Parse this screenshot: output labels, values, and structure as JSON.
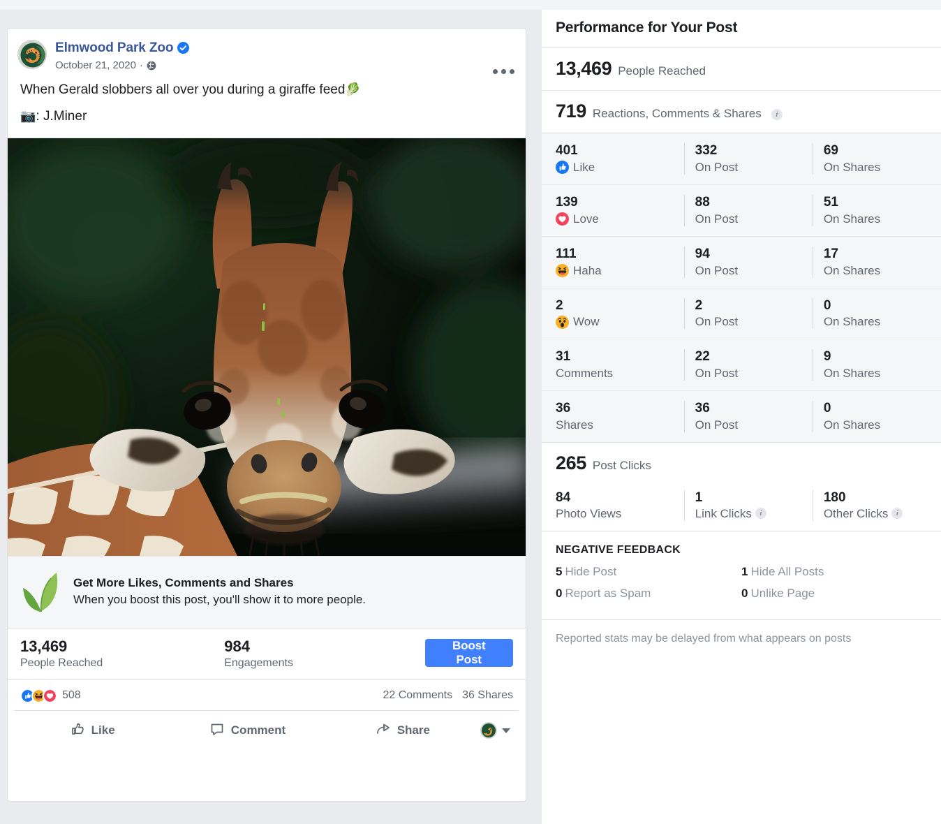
{
  "post": {
    "page_name": "Elmwood Park Zoo",
    "verified_icon": "verified-badge-icon",
    "date": "October 21, 2020",
    "date_separator": "·",
    "audience_icon": "globe-icon",
    "menu_icon": "more-options-icon",
    "text_line_1": "When Gerald slobbers all over you during a giraffe feed",
    "text_line_1_emoji": "🥬",
    "text_line_2_emoji": "📷",
    "text_line_2": ": J.Miner",
    "photo_alt": "giraffe-photo"
  },
  "promo": {
    "icon": "leaf-icon",
    "title": "Get More Likes, Comments and Shares",
    "subtitle": "When you boost this post, you'll show it to more people."
  },
  "metrics": {
    "reach_value": "13,469",
    "reach_label": "People Reached",
    "engagements_value": "984",
    "engagements_label": "Engagements",
    "boost_button": "Boost Post"
  },
  "reactbar": {
    "count": "508",
    "comments": "22 Comments",
    "shares": "36 Shares",
    "pills": [
      "like-icon",
      "haha-icon",
      "love-icon"
    ]
  },
  "actions": {
    "like": "Like",
    "comment": "Comment",
    "share": "Share",
    "like_icon": "thumbs-up-icon",
    "comment_icon": "comment-bubble-icon",
    "share_icon": "share-arrow-icon",
    "share_as_icon": "page-avatar-icon",
    "share_as_caret": "chevron-down-icon"
  },
  "performance": {
    "title": "Performance for Your Post",
    "reach": {
      "value": "13,469",
      "label": "People Reached"
    },
    "engagement": {
      "value": "719",
      "label": "Reactions, Comments & Shares",
      "info": "info-icon"
    },
    "rows": [
      {
        "icon": "like-icon",
        "total": "401",
        "label": "Like",
        "on_post": "332",
        "on_post_label": "On Post",
        "on_shares": "69",
        "on_shares_label": "On Shares"
      },
      {
        "icon": "love-icon",
        "total": "139",
        "label": "Love",
        "on_post": "88",
        "on_post_label": "On Post",
        "on_shares": "51",
        "on_shares_label": "On Shares"
      },
      {
        "icon": "haha-icon",
        "total": "111",
        "label": "Haha",
        "on_post": "94",
        "on_post_label": "On Post",
        "on_shares": "17",
        "on_shares_label": "On Shares"
      },
      {
        "icon": "wow-icon",
        "total": "2",
        "label": "Wow",
        "on_post": "2",
        "on_post_label": "On Post",
        "on_shares": "0",
        "on_shares_label": "On Shares"
      },
      {
        "icon": "",
        "total": "31",
        "label": "Comments",
        "on_post": "22",
        "on_post_label": "On Post",
        "on_shares": "9",
        "on_shares_label": "On Shares"
      },
      {
        "icon": "",
        "total": "36",
        "label": "Shares",
        "on_post": "36",
        "on_post_label": "On Post",
        "on_shares": "0",
        "on_shares_label": "On Shares"
      }
    ],
    "clicks": {
      "value": "265",
      "label": "Post Clicks",
      "photo_views": "84",
      "photo_views_label": "Photo Views",
      "link_clicks": "1",
      "link_clicks_label": "Link Clicks",
      "other_clicks": "180",
      "other_clicks_label": "Other Clicks"
    },
    "negative_feedback": {
      "title": "NEGATIVE FEEDBACK",
      "items": [
        {
          "value": "5",
          "label": "Hide Post"
        },
        {
          "value": "1",
          "label": "Hide All Posts"
        },
        {
          "value": "0",
          "label": "Report as Spam"
        },
        {
          "value": "0",
          "label": "Unlike Page"
        }
      ]
    },
    "footnote": "Reported stats may be delayed from what appears on posts"
  },
  "colors": {
    "brand_blue": "#1877f2",
    "link_blue": "#385898",
    "boost_blue": "#4080ff",
    "love_red": "#f3425f",
    "haha_yellow": "#f7b125",
    "page_bg": "#e9ebee",
    "panel_bg": "#f5f6f7",
    "text": "#1c1e21",
    "muted": "#606770"
  }
}
